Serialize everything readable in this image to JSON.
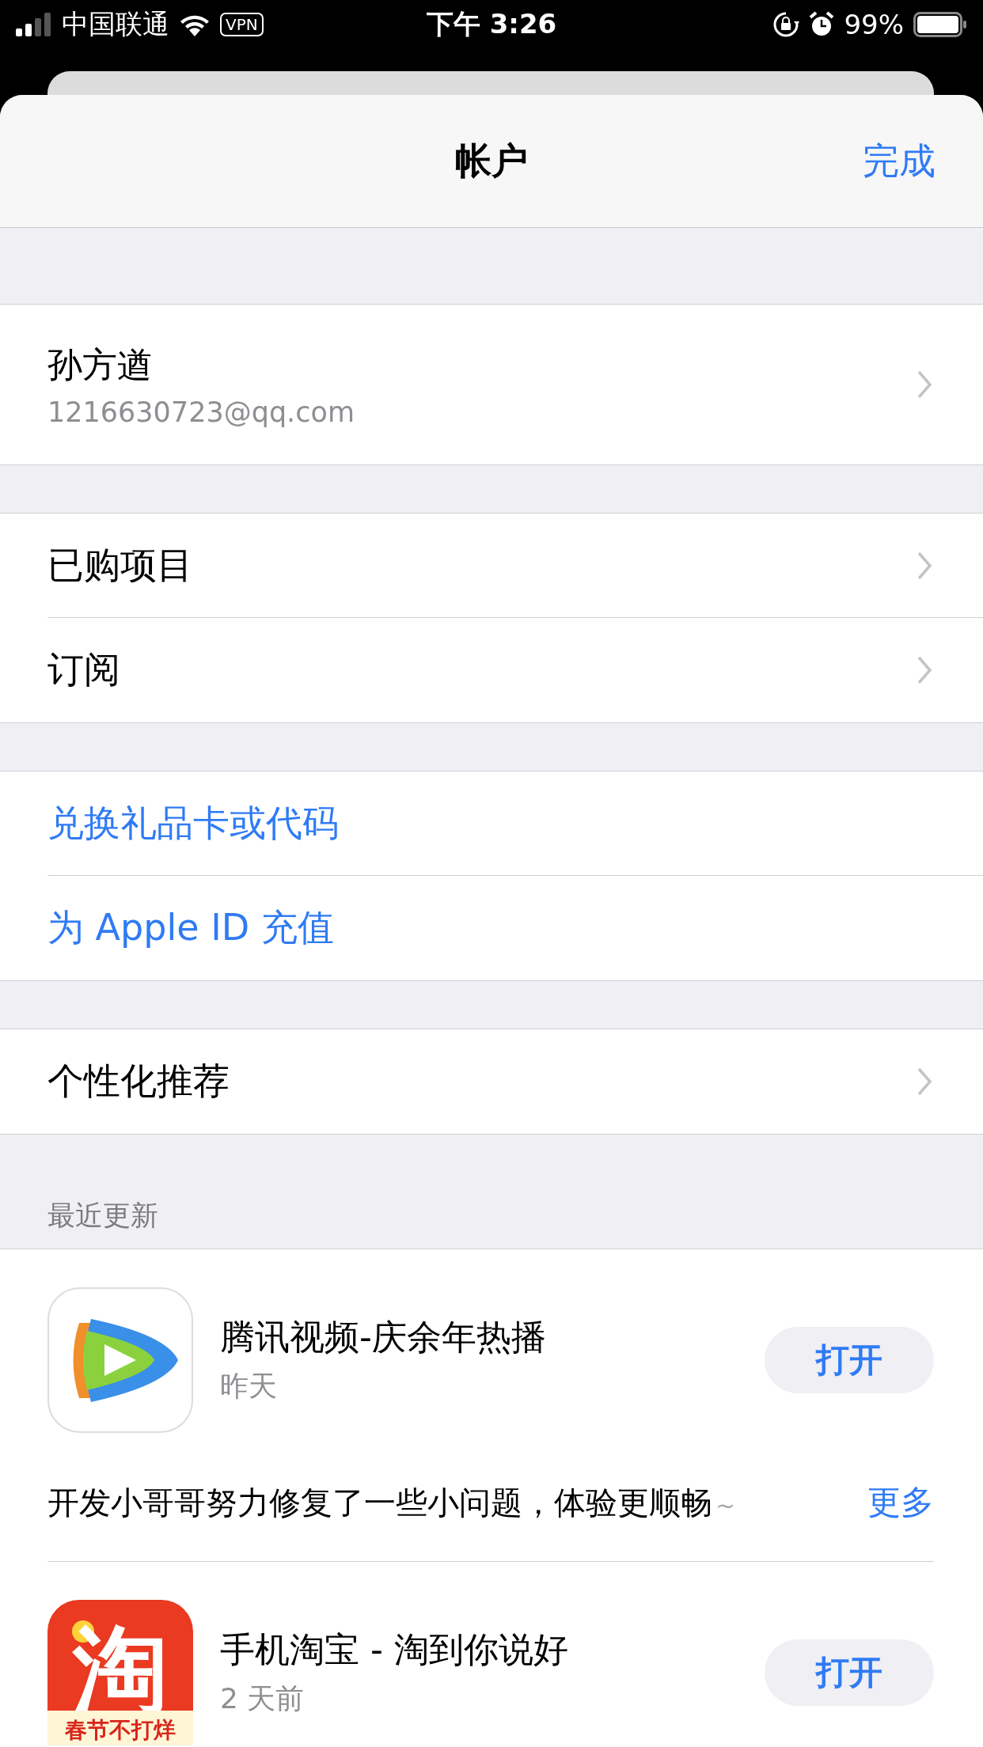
{
  "status_bar": {
    "carrier": "中国联通",
    "vpn": "VPN",
    "time": "下午 3:26",
    "battery": "99%"
  },
  "nav": {
    "title": "帐户",
    "done": "完成"
  },
  "account": {
    "name": "孙方遒",
    "email": "1216630723@qq.com"
  },
  "groups": [
    [
      {
        "label": "已购项目",
        "kind": "nav"
      },
      {
        "label": "订阅",
        "kind": "nav"
      }
    ],
    [
      {
        "label": "兑换礼品卡或代码",
        "kind": "action"
      },
      {
        "label": "为 Apple ID 充值",
        "kind": "action"
      }
    ],
    [
      {
        "label": "个性化推荐",
        "kind": "nav"
      }
    ]
  ],
  "updates": {
    "header": "最近更新",
    "apps": [
      {
        "name": "腾讯视频-庆余年热播",
        "date": "昨天",
        "button": "打开",
        "kind": "video",
        "notes": "开发小哥哥努力修复了一些小问题，体验更顺畅",
        "notes_tail": "~",
        "more": "更多"
      },
      {
        "name": "手机淘宝 - 淘到你说好",
        "date": "2 天前",
        "button": "打开",
        "kind": "shop",
        "icon_char": "淘",
        "icon_banner": "春节不打烊"
      }
    ]
  }
}
